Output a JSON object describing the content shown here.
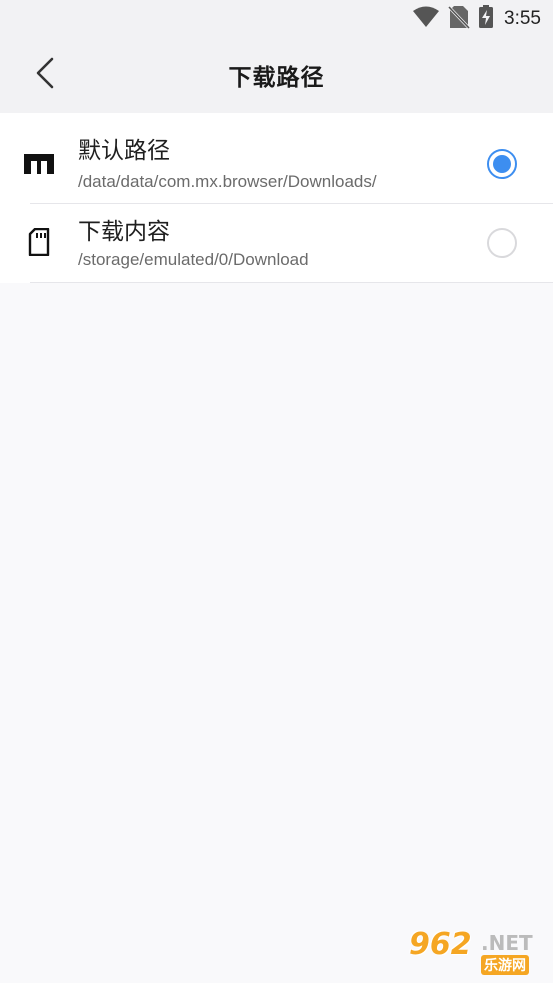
{
  "status_bar": {
    "time": "3:55",
    "icons": [
      "wifi-icon",
      "no-sim-icon",
      "battery-charging-icon"
    ]
  },
  "app_bar": {
    "back_icon": "chevron-left-icon",
    "title": "下载路径"
  },
  "options": [
    {
      "title": "默认路径",
      "path": "/data/data/com.mx.browser/Downloads/",
      "icon": "internal-storage-icon",
      "selected": true
    },
    {
      "title": "下载内容",
      "path": "/storage/emulated/0/Download",
      "icon": "sd-card-icon",
      "selected": false
    }
  ],
  "colors": {
    "accent": "#3d8ef0",
    "background": "#f9f9fb",
    "header": "#f2f2f4"
  },
  "watermark": {
    "number": "962",
    "suffix": ".NET",
    "site": "乐游网"
  }
}
